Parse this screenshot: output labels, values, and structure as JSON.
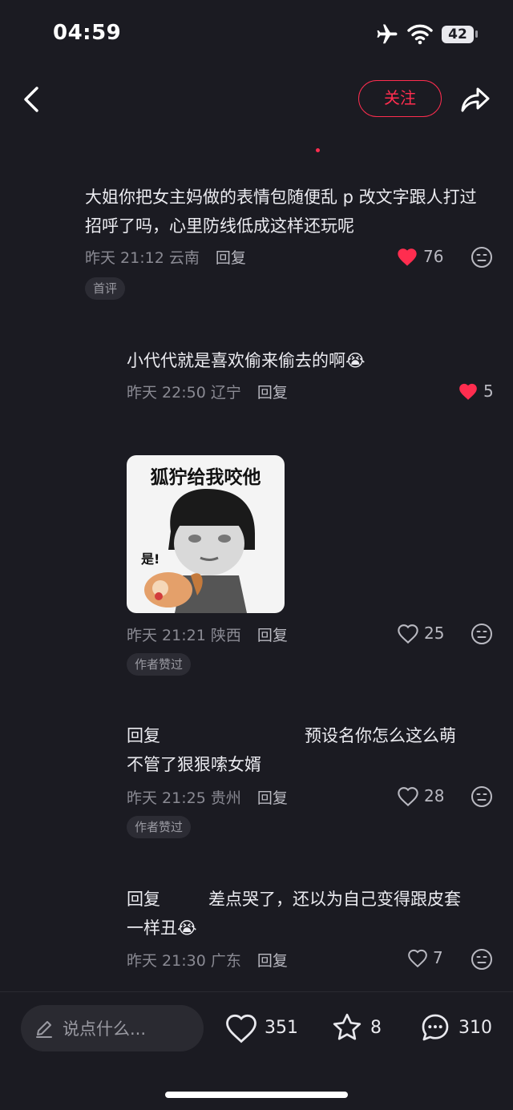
{
  "status_bar": {
    "time": "04:59",
    "battery": "42"
  },
  "header": {
    "follow_label": "关注"
  },
  "comments": [
    {
      "text": "大姐你把女主妈做的表情包随便乱 p 改文字跟人打过招呼了吗，心里防线低成这样还玩呢",
      "time": "昨天 21:12",
      "location": "云南",
      "reply_label": "回复",
      "likes": "76",
      "liked": true,
      "tag": "首评"
    },
    {
      "text": "小代代就是喜欢偷来偷去的啊",
      "emoji": "😭",
      "time": "昨天 22:50",
      "location": "辽宁",
      "reply_label": "回复",
      "likes": "5",
      "liked": true
    },
    {
      "sticker_caption": "狐狞给我咬他",
      "sticker_label": "是!",
      "time": "昨天 21:21",
      "location": "陕西",
      "reply_label": "回复",
      "likes": "25",
      "liked": false,
      "tag": "作者赞过"
    },
    {
      "reply_prefix": "回复",
      "text_line1": "预设名你怎么这么萌",
      "text_line2": "不管了狠狠嗦女婿",
      "time": "昨天 21:25",
      "location": "贵州",
      "reply_label": "回复",
      "likes": "28",
      "liked": false,
      "tag": "作者赞过"
    },
    {
      "reply_prefix": "回复",
      "text_line1": "差点哭了，还以为自己变得跟皮套",
      "text_line2": "一样丑",
      "emoji": "😭",
      "time": "昨天 21:30",
      "location": "广东",
      "reply_label": "回复",
      "likes": "7",
      "liked": false
    }
  ],
  "bottom_bar": {
    "input_placeholder": "说点什么...",
    "likes": "351",
    "favorites": "8",
    "comments": "310"
  },
  "colors": {
    "accent": "#ff2d4f",
    "background": "#1b1b22",
    "heart_red": "#ff2d4f"
  }
}
